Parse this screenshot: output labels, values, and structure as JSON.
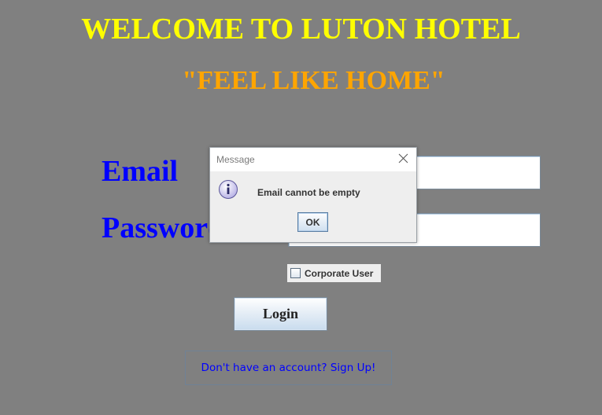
{
  "header": {
    "title": "WELCOME TO LUTON HOTEL",
    "tagline": "\"FEEL LIKE HOME\""
  },
  "form": {
    "email_label": "Email",
    "email_value": "",
    "password_label": "Password",
    "password_value": "",
    "corporate_checkbox_label": "Corporate User",
    "corporate_checked": false,
    "login_label": "Login",
    "signup_link": "Don't have an account? Sign Up!"
  },
  "dialog": {
    "title": "Message",
    "message": "Email cannot be empty",
    "ok_label": "OK",
    "icon": "info-icon",
    "close_icon": "close-icon"
  },
  "colors": {
    "background": "#808080",
    "title": "#ffff00",
    "tagline": "#ffa500",
    "labels": "#0000ff",
    "link": "#0000ff"
  }
}
